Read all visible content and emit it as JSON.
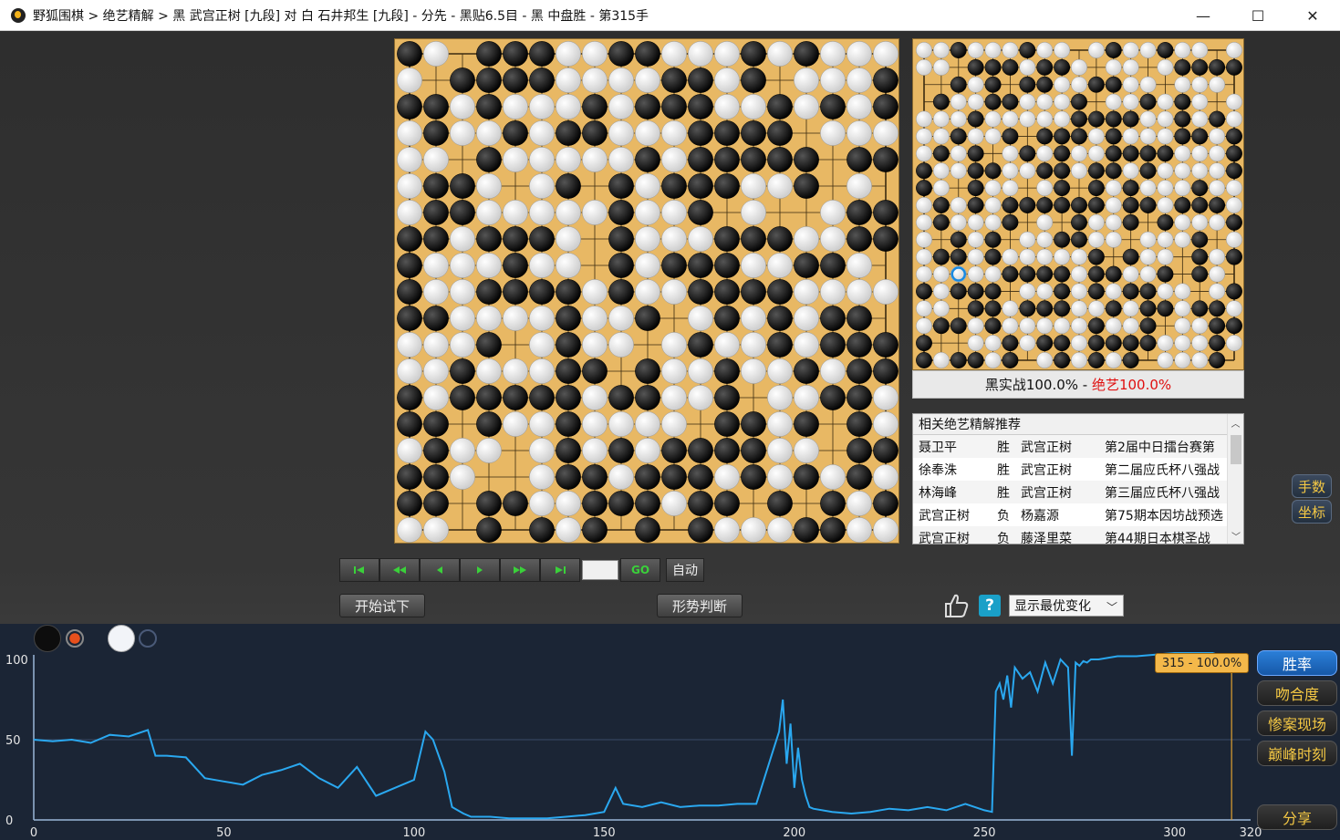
{
  "window": {
    "title": "野狐围棋 > 绝艺精解 > 黑 武宫正树 [九段] 对 白 石井邦生 [九段] - 分先 - 黑贴6.5目 - 黑 中盘胜 - 第315手",
    "minimize": "—",
    "maximize": "☐",
    "close": "✕"
  },
  "score": {
    "black_label": "黑实战100.0%",
    "separator": " - ",
    "ai_label": "绝艺100.0%"
  },
  "recommendations": {
    "header": "相关绝艺精解推荐",
    "rows": [
      {
        "player": "聂卫平",
        "result": "胜",
        "opponent": "武宫正树",
        "event": "第2届中日擂台赛第"
      },
      {
        "player": "徐奉洙",
        "result": "胜",
        "opponent": "武宫正树",
        "event": "第二届应氏杯八强战"
      },
      {
        "player": "林海峰",
        "result": "胜",
        "opponent": "武宫正树",
        "event": "第三届应氏杯八强战"
      },
      {
        "player": "武宫正树",
        "result": "负",
        "opponent": "杨嘉源",
        "event": "第75期本因坊战预选"
      },
      {
        "player": "武宫正树",
        "result": "负",
        "opponent": "藤泽里菜",
        "event": "第44期日本棋圣战"
      }
    ]
  },
  "side_buttons": {
    "moves": "手数",
    "coords": "坐标"
  },
  "nav": {
    "first": "▶|",
    "prev10": "◀◀",
    "prev": "◀",
    "next": "▶",
    "next10": "▶▶",
    "last": "▶|",
    "go": "GO",
    "auto": "自动",
    "move_input": ""
  },
  "actions": {
    "try": "开始试下",
    "judge": "形势判断",
    "variation": "显示最优变化"
  },
  "chart": {
    "tag": "315 - 100.0%",
    "buttons": {
      "winrate": "胜率",
      "match": "吻合度",
      "disaster": "惨案现场",
      "peak": "巅峰时刻",
      "share": "分享"
    }
  },
  "chart_data": {
    "type": "line",
    "title": "",
    "xlabel": "",
    "ylabel": "",
    "xlim": [
      0,
      320
    ],
    "ylim": [
      0,
      100
    ],
    "x_ticks": [
      0,
      50,
      100,
      150,
      200,
      250,
      300,
      320
    ],
    "y_ticks": [
      0,
      50,
      100
    ],
    "current_move": 315,
    "series": [
      {
        "color": "#2aa8f0",
        "x": [
          0,
          5,
          10,
          15,
          20,
          25,
          30,
          32,
          35,
          40,
          45,
          50,
          55,
          60,
          65,
          70,
          75,
          80,
          85,
          90,
          95,
          100,
          103,
          105,
          108,
          110,
          113,
          115,
          120,
          125,
          130,
          135,
          140,
          145,
          150,
          153,
          155,
          160,
          165,
          170,
          175,
          180,
          185,
          190,
          194,
          196,
          197,
          198,
          199,
          200,
          201,
          202,
          203,
          204,
          205,
          210,
          215,
          220,
          225,
          230,
          235,
          240,
          245,
          250,
          252,
          253,
          254,
          255,
          256,
          257,
          258,
          260,
          262,
          264,
          266,
          268,
          270,
          272,
          273,
          274,
          275,
          276,
          277,
          278,
          280,
          285,
          290,
          295,
          300,
          305,
          310,
          315
        ],
        "values": [
          50,
          49,
          50,
          48,
          53,
          52,
          56,
          40,
          40,
          39,
          26,
          24,
          22,
          28,
          31,
          35,
          26,
          20,
          33,
          15,
          20,
          25,
          55,
          50,
          30,
          8,
          4,
          2,
          2,
          1,
          1,
          1,
          2,
          3,
          5,
          20,
          10,
          8,
          11,
          8,
          9,
          9,
          10,
          10,
          40,
          55,
          75,
          35,
          60,
          20,
          45,
          25,
          15,
          8,
          7,
          5,
          4,
          5,
          7,
          6,
          8,
          6,
          10,
          6,
          5,
          80,
          85,
          75,
          90,
          70,
          95,
          88,
          92,
          80,
          98,
          85,
          100,
          95,
          40,
          98,
          96,
          99,
          98,
          100,
          100,
          102,
          102,
          103,
          104,
          104,
          104,
          100
        ]
      }
    ]
  }
}
